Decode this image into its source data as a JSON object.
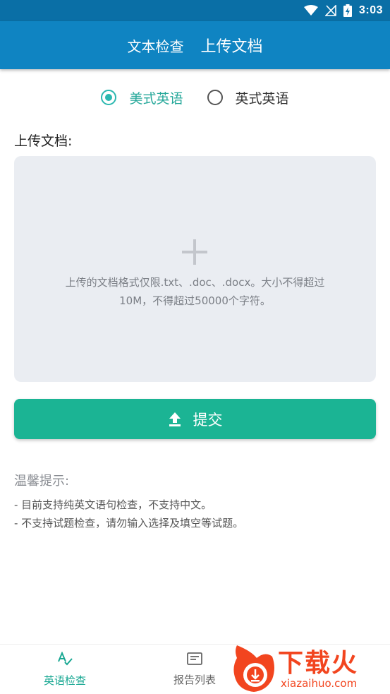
{
  "status_bar": {
    "time": "3:03",
    "icons": [
      "wifi-icon",
      "no-signal-icon",
      "battery-charging-icon"
    ]
  },
  "app_bar": {
    "tabs": [
      {
        "label": "文本检查",
        "active": false
      },
      {
        "label": "上传文档",
        "active": true
      }
    ]
  },
  "language_options": [
    {
      "label": "美式英语",
      "checked": true
    },
    {
      "label": "英式英语",
      "checked": false
    }
  ],
  "upload": {
    "section_label": "上传文档:",
    "hint_line1": "上传的文档格式仅限.txt、.doc、.docx。大小不得超过",
    "hint_line2": "10M，不得超过50000个字符。",
    "icon": "plus-icon"
  },
  "submit": {
    "label": "提交",
    "icon": "upload-icon"
  },
  "tips": {
    "title": "温馨提示:",
    "items": [
      "- 目前支持纯英文语句检查，不支持中文。",
      "- 不支持试题检查，请勿输入选择及填空等试题。"
    ]
  },
  "bottom_nav": [
    {
      "label": "英语检查",
      "icon": "spell-check-icon",
      "active": true
    },
    {
      "label": "报告列表",
      "icon": "report-list-icon",
      "active": false
    }
  ],
  "watermark": {
    "cn": "下载火",
    "en": "xiazaihuo.com"
  },
  "colors": {
    "status_bar": "#0a6fa6",
    "app_bar": "#0f84c2",
    "accent": "#1bb494",
    "radio_checked": "#2bb8b0",
    "dropzone_bg": "#eaedf2",
    "watermark": "#f2451f"
  }
}
